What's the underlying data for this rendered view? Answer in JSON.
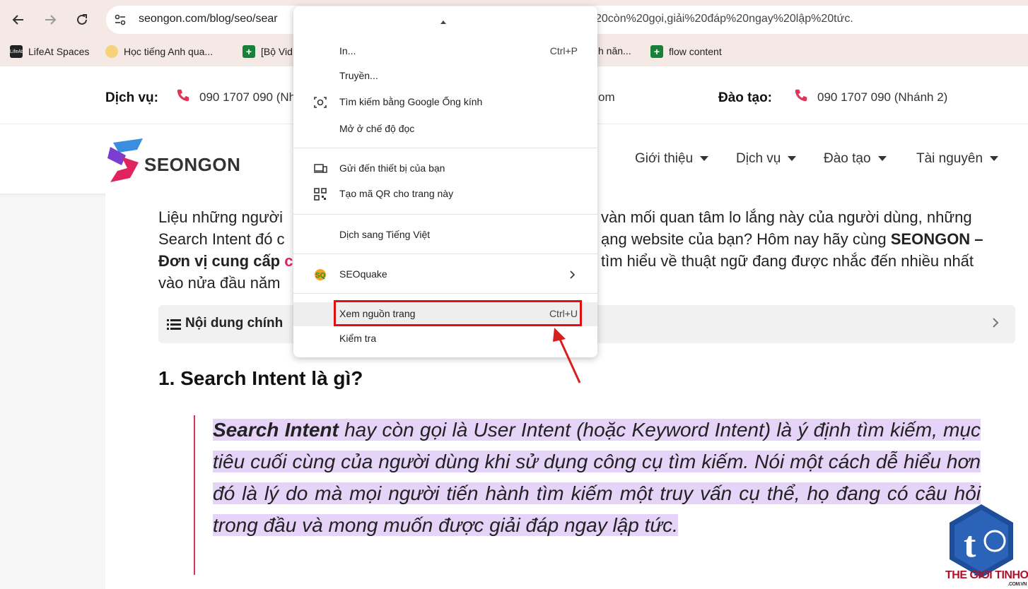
{
  "browser": {
    "url_left": "seongon.com/blog/seo/sear",
    "url_right": "20còn%20gọi,giải%20đáp%20ngay%20lập%20tức.",
    "bookmarks": [
      {
        "label": "LifeAt Spaces",
        "icon_text": "LifeAt"
      },
      {
        "label": "Học tiếng Anh qua..."
      },
      {
        "label": "[Bộ Vid"
      },
      {
        "label": "h năn..."
      },
      {
        "label": "flow content"
      }
    ]
  },
  "topbar": {
    "service_label": "Dịch vụ:",
    "service_phone": "090 1707 090 (Nh",
    "email_partial": "om",
    "training_label": "Đào tạo:",
    "training_phone": "090 1707 090 (Nhánh 2)"
  },
  "header": {
    "logo": "SEONGON",
    "menu": [
      "Giới thiệu",
      "Dịch vụ",
      "Đào tạo",
      "Tài nguyên"
    ]
  },
  "article": {
    "intro_line1_a": "Liệu những người",
    "intro_line1_b": "vàn mối quan tâm lo lắng này của người dùng, những",
    "intro_line2_a": "Search Intent đó c",
    "intro_line2_b": "ạng website của bạn? Hôm nay hãy cùng",
    "intro_line2_bold": "SEONGON –",
    "intro_line3_bold": "Đơn vị cung cấp",
    "intro_line3_red": "c",
    "intro_line3_b": "tìm hiểu về thuật ngữ đang được nhắc đến nhiều nhất",
    "intro_line4": "vào nửa đầu năm",
    "toc_label": "Nội dung chính",
    "heading": "1. Search Intent là gì?",
    "quote_bold": "Search Intent",
    "quote_rest": "hay còn gọi là User Intent (hoặc Keyword Intent) là ý định tìm kiếm, mục tiêu cuối cùng của người dùng khi sử dụng công cụ tìm kiếm. Nói một cách dễ hiểu hơn đó là lý do mà mọi người tiến hành tìm kiếm một truy vấn cụ thể, họ đang có câu hỏi trong đầu và mong muốn được giải đáp ngay lập tức."
  },
  "context_menu": {
    "items": [
      {
        "label": "In...",
        "shortcut": "Ctrl+P"
      },
      {
        "label": "Truyền..."
      },
      {
        "label": "Tìm kiếm bằng Google Ống kính",
        "icon": "lens-icon"
      },
      {
        "label": "Mở ở chế độ đọc"
      },
      {
        "label": "Gửi đến thiết bị của bạn",
        "icon": "devices-icon"
      },
      {
        "label": "Tạo mã QR cho trang này",
        "icon": "qr-icon"
      },
      {
        "label": "Dịch sang Tiếng Việt"
      },
      {
        "label": "SEOquake",
        "icon": "seoquake-icon"
      },
      {
        "label": "Xem nguồn trang",
        "shortcut": "Ctrl+U"
      },
      {
        "label": "Kiểm tra"
      }
    ]
  },
  "watermark": {
    "text": "THE GIOI TINHOC",
    "sub": ".COM.VN"
  }
}
